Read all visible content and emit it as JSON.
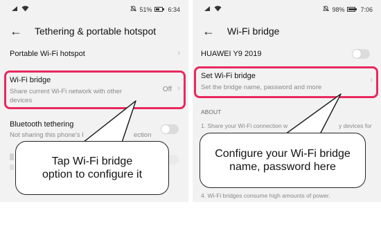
{
  "left": {
    "status": {
      "percent": "51%",
      "time": "6:34"
    },
    "title": "Tethering & portable hotspot",
    "rows": [
      {
        "title": "Portable Wi-Fi hotspot"
      },
      {
        "title": "Wi-Fi bridge",
        "subtitle_line1": "Share current Wi-Fi network with other",
        "subtitle_line2": "devices",
        "value": "Off"
      },
      {
        "title": "Bluetooth tethering",
        "subtitle": "Not sharing this phone's Internet connection",
        "subtitle_tail": "ection"
      }
    ],
    "callout": {
      "line1": "Tap Wi-Fi bridge",
      "line2": "option to configure it"
    }
  },
  "right": {
    "status": {
      "percent": "98%",
      "time": "7:06"
    },
    "title": "Wi-Fi bridge",
    "device_name": "HUAWEI Y9 2019",
    "set_row": {
      "title": "Set Wi-Fi bridge",
      "subtitle": "Set the bridge name, password and more"
    },
    "about_label": "ABOUT",
    "about_1_start": "1. Share your Wi-Fi connection w",
    "about_1_end": "y devices for",
    "about_4": "4. Wi-Fi bridges consume high amounts of power.",
    "callout": {
      "line1": "Configure your Wi-Fi bridge",
      "line2": "name, password here"
    }
  },
  "colors": {
    "highlight": "#e8285e",
    "background": "#f2f2f2"
  }
}
